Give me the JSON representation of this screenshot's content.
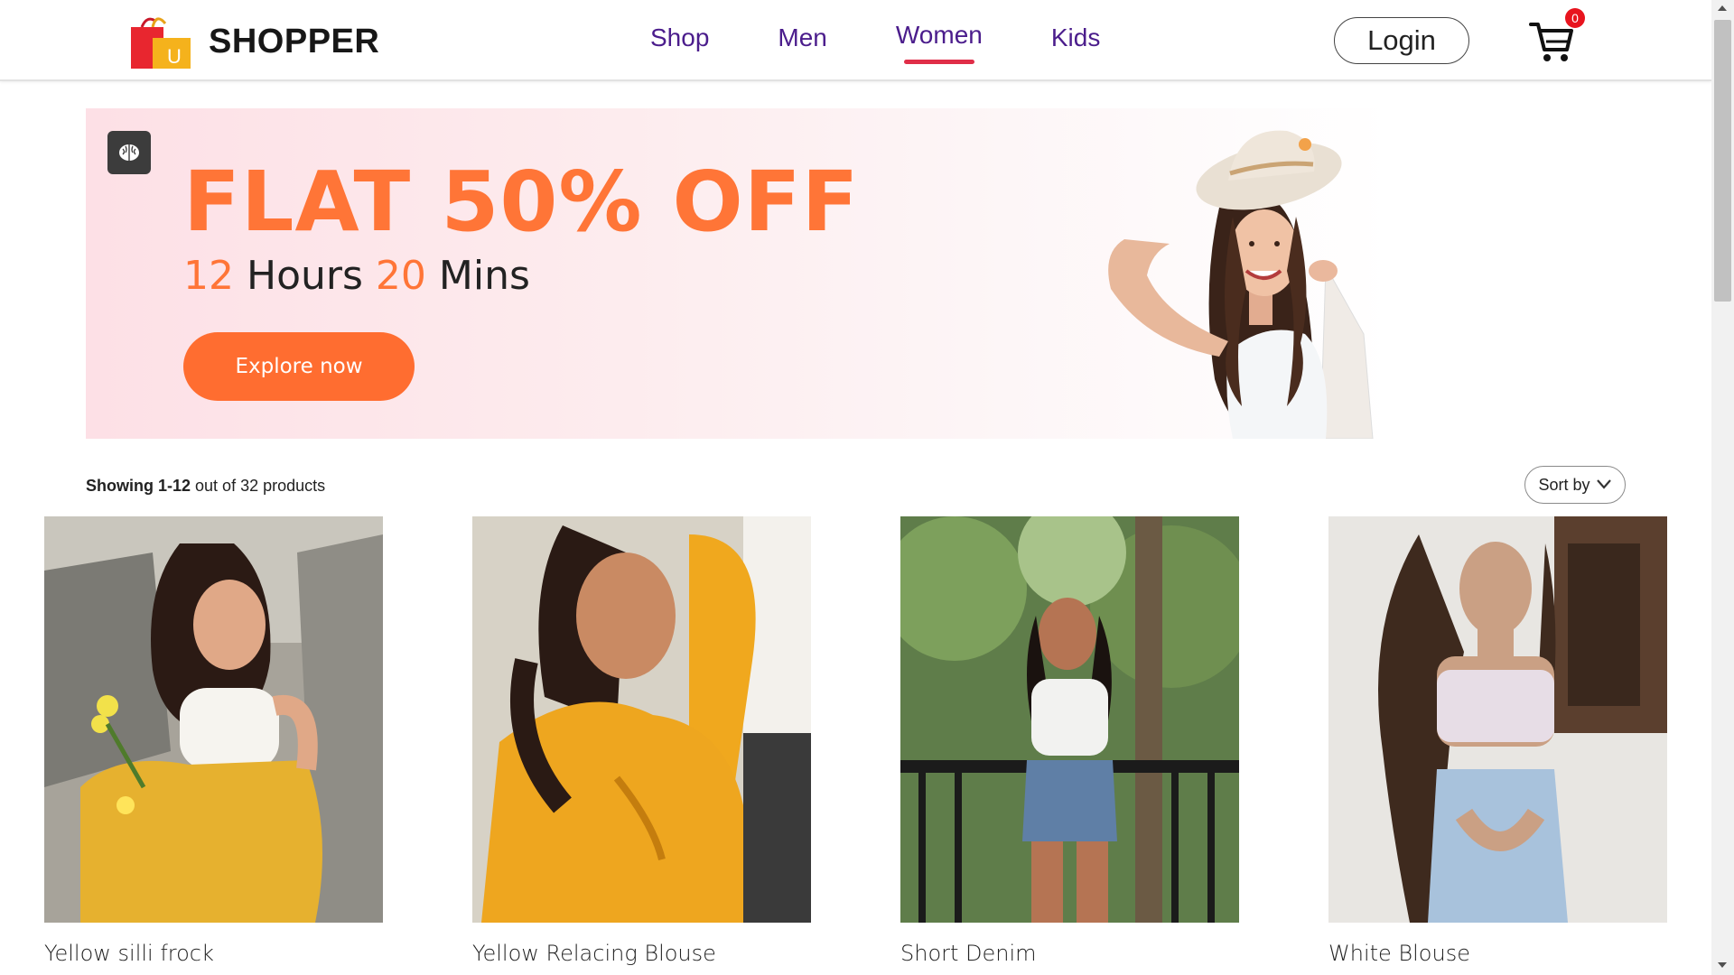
{
  "brand": {
    "name": "SHOPPER",
    "logo_letter": "U"
  },
  "nav": {
    "items": [
      {
        "label": "Shop",
        "active": false
      },
      {
        "label": "Men",
        "active": false
      },
      {
        "label": "Women",
        "active": true
      },
      {
        "label": "Kids",
        "active": false
      }
    ],
    "active_color": "#e02e48",
    "link_color": "#4b1d8c"
  },
  "header": {
    "login_label": "Login",
    "cart_count": "0",
    "cart_icon": "cart-icon"
  },
  "hero": {
    "title": "FLAT 50% OFF",
    "hours": "12",
    "hours_label": "Hours",
    "mins": "20",
    "mins_label": "Mins",
    "cta_label": "Explore now",
    "accent_color": "#ff7537",
    "badge_icon": "brain-icon"
  },
  "listing": {
    "showing_range": "Showing 1-12",
    "showing_rest": "out of 32 products",
    "sort_label": "Sort by",
    "sort_icon": "chevron-down-icon"
  },
  "products": [
    {
      "name": "Yellow silli frock"
    },
    {
      "name": "Yellow Relacing Blouse"
    },
    {
      "name": "Short Denim"
    },
    {
      "name": "White Blouse"
    }
  ]
}
